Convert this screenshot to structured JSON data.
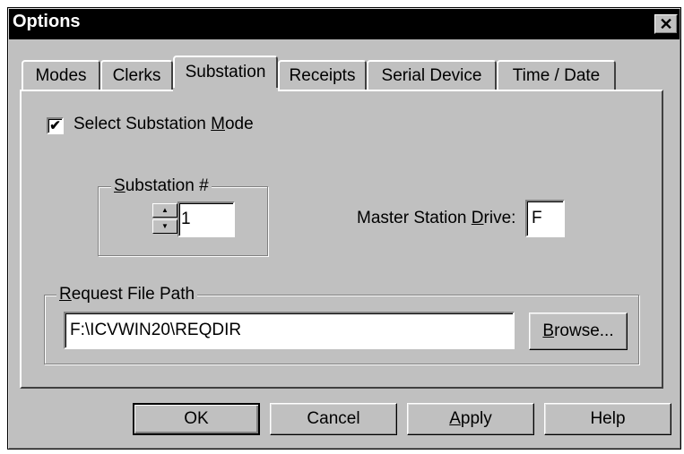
{
  "window": {
    "title": "Options"
  },
  "tabs": [
    {
      "label": "Modes"
    },
    {
      "label": "Clerks"
    },
    {
      "label": "Substation",
      "active": true
    },
    {
      "label": "Receipts"
    },
    {
      "label": "Serial Device"
    },
    {
      "label": "Time / Date"
    }
  ],
  "substation": {
    "select_mode": {
      "label_pre": "Select Substation ",
      "mnemonic": "M",
      "label_post": "ode",
      "checked": true
    },
    "number_group": {
      "mnemonic": "S",
      "label_rest": "ubstation #",
      "value": "1"
    },
    "master_drive": {
      "label_pre": "Master Station ",
      "mnemonic": "D",
      "label_post": "rive:",
      "value": "F"
    },
    "request_path": {
      "mnemonic": "R",
      "label_rest": "equest File Path",
      "value": "F:\\ICVWIN20\\REQDIR",
      "browse_mnemonic": "B",
      "browse_rest": "rowse..."
    }
  },
  "buttons": {
    "ok": "OK",
    "cancel": "Cancel",
    "apply_mnemonic": "A",
    "apply_rest": "pply",
    "help": "Help"
  },
  "colors": {
    "face": "#c0c0c0",
    "titlebar": "#000000"
  },
  "icons": {
    "close": "close-icon",
    "check": "check-icon",
    "spin_up": "arrow-up-icon",
    "spin_down": "arrow-down-icon"
  }
}
